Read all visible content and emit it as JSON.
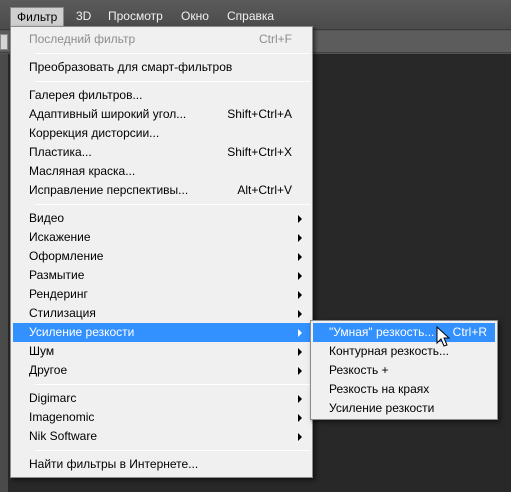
{
  "menubar": {
    "items": [
      {
        "label": "Фильтр"
      },
      {
        "label": "3D"
      },
      {
        "label": "Просмотр"
      },
      {
        "label": "Окно"
      },
      {
        "label": "Справка"
      }
    ]
  },
  "filter_menu": {
    "last_filter": {
      "label": "Последний фильтр",
      "shortcut": "Ctrl+F"
    },
    "convert_smart": {
      "label": "Преобразовать для смарт-фильтров"
    },
    "gallery": {
      "label": "Галерея фильтров..."
    },
    "wide_angle": {
      "label": "Адаптивный широкий угол...",
      "shortcut": "Shift+Ctrl+A"
    },
    "lens_correction": {
      "label": "Коррекция дисторсии..."
    },
    "liquify": {
      "label": "Пластика...",
      "shortcut": "Shift+Ctrl+X"
    },
    "oil_paint": {
      "label": "Масляная краска..."
    },
    "vanishing_point": {
      "label": "Исправление перспективы...",
      "shortcut": "Alt+Ctrl+V"
    },
    "video": {
      "label": "Видео"
    },
    "distort": {
      "label": "Искажение"
    },
    "stylize_design": {
      "label": "Оформление"
    },
    "blur": {
      "label": "Размытие"
    },
    "render": {
      "label": "Рендеринг"
    },
    "stylize": {
      "label": "Стилизация"
    },
    "sharpen": {
      "label": "Усиление резкости"
    },
    "noise": {
      "label": "Шум"
    },
    "other": {
      "label": "Другое"
    },
    "digimarc": {
      "label": "Digimarc"
    },
    "imagenomic": {
      "label": "Imagenomic"
    },
    "nik": {
      "label": "Nik Software"
    },
    "browse_online": {
      "label": "Найти фильтры в Интернете..."
    }
  },
  "sharpen_submenu": {
    "smart_sharpen": {
      "label": "\"Умная\" резкость...",
      "shortcut": "Ctrl+R"
    },
    "unsharp_mask": {
      "label": "Контурная резкость..."
    },
    "sharpen_plus": {
      "label": "Резкость +"
    },
    "sharpen_edges": {
      "label": "Резкость на краях"
    },
    "sharpen": {
      "label": "Усиление резкости"
    }
  },
  "colors": {
    "highlight": "#3390ff",
    "menu_bg": "#f0f0f0",
    "canvas": "#282828",
    "menubar": "#4f4f4f"
  }
}
